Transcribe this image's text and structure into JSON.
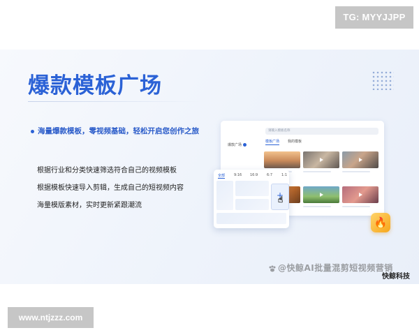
{
  "overlay": {
    "tg_label": "TG: MYYJJPP",
    "url_label": "www.ntjzzz.com"
  },
  "slide": {
    "title": "爆款模板广场",
    "subtitle": "海量爆款模板，零视频基础，轻松开启您创作之旅",
    "features": [
      "根据行业和分类快速筛选符合自己的视频模板",
      "根据模板快速导入剪辑，生成自己的短视频内容",
      "海量模版素材，实时更新紧跟潮流"
    ],
    "watermark": "@快鲸AI批量混剪短视频营销",
    "brand": "快鲸科技"
  },
  "mockup": {
    "search_placeholder": "请输入模板名称",
    "sidebar_item": "爆款广场",
    "tabs": [
      "模板广场",
      "我的模板"
    ],
    "ratio_tabs": [
      "全部",
      "9:16",
      "16:9",
      "6:7",
      "1:1"
    ],
    "add_symbol": "+"
  },
  "colors": {
    "accent": "#2b62d6",
    "overlay_gray": "#c6c6c6",
    "fire_button": "#f6a61a"
  },
  "icons": {
    "play": "play-icon",
    "cursor": "pointer-cursor-icon",
    "fire": "fire-icon",
    "watermark": "paw-icon"
  }
}
